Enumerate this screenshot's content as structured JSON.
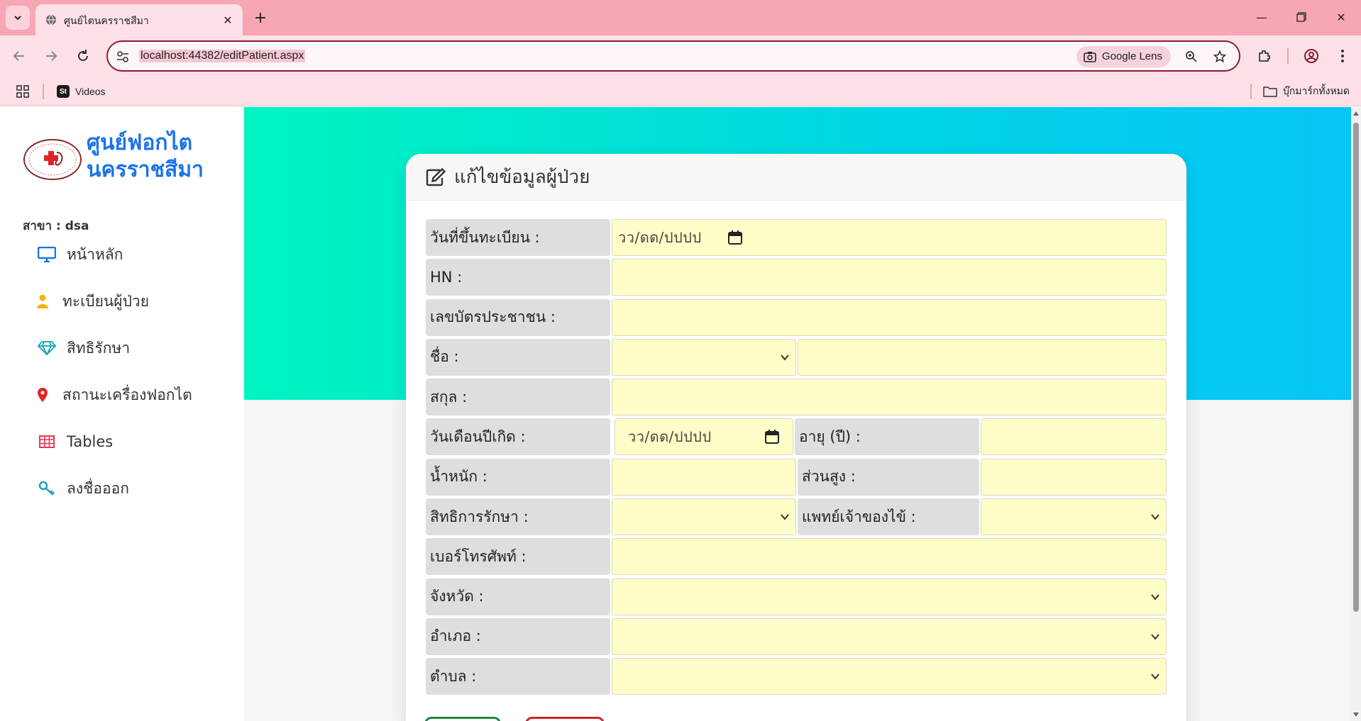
{
  "browser": {
    "tab_title": "ศูนย์ไตนครราชสีมา",
    "url": "localhost:44382/editPatient.aspx",
    "lens_label": "Google Lens",
    "bookmarks": [
      {
        "label": "Videos",
        "favicon_text": "St"
      }
    ],
    "all_bookmarks_label": "บุ๊กมาร์กทั้งหมด"
  },
  "sidebar": {
    "brand_line1": "ศูนย์ฟอกไต",
    "brand_line2": "นครราชสีมา",
    "branch": "สาขา : dsa",
    "items": [
      {
        "label": "หน้าหลัก",
        "icon": "monitor-icon",
        "color": "#1a73e8"
      },
      {
        "label": "ทะเบียนผู้ป่วย",
        "icon": "user-icon",
        "color": "#f5b400"
      },
      {
        "label": "สิทธิรักษา",
        "icon": "diamond-icon",
        "color": "#17a2b8"
      },
      {
        "label": "สถานะเครื่องฟอกไต",
        "icon": "map-pin-icon",
        "color": "#e02424"
      },
      {
        "label": "Tables",
        "icon": "table-icon",
        "color": "#e8375a"
      },
      {
        "label": "ลงชื่อออก",
        "icon": "key-icon",
        "color": "#17a2b8"
      }
    ]
  },
  "form": {
    "title": "แก้ไขข้อมูลผู้ป่วย",
    "register_date_label": "วันที่ขึ้นทะเบียน :",
    "register_date_placeholder": "วว/ดด/ปปปป",
    "hn_label": "HN :",
    "hn_value": "",
    "citizen_id_label": "เลขบัตรประชาชน :",
    "citizen_id_value": "",
    "name_label": "ชื่อ :",
    "name_prefix_value": "",
    "name_value": "",
    "surname_label": "สกุล :",
    "surname_value": "",
    "birth_date_label": "วันเดือนปีเกิด :",
    "birth_date_placeholder": "วว/ดด/ปปปป",
    "age_label": "อายุ (ปี) :",
    "age_value": "",
    "weight_label": "น้ำหนัก :",
    "weight_value": "",
    "height_label": "ส่วนสูง :",
    "height_value": "",
    "right_label": "สิทธิการรักษา :",
    "right_value": "",
    "doctor_label": "แพทย์เจ้าของไข้ :",
    "doctor_value": "",
    "phone_label": "เบอร์โทรศัพท์ :",
    "phone_value": "",
    "province_label": "จังหวัด :",
    "province_value": "",
    "district_label": "อำเภอ :",
    "district_value": "",
    "subdistrict_label": "ตำบล :",
    "subdistrict_value": ""
  },
  "colors": {
    "field_bg": "#fffec8",
    "label_bg": "#dedede",
    "save_border": "#1e8a3c",
    "cancel_border": "#d0202e",
    "brand": "#1a73e8"
  }
}
